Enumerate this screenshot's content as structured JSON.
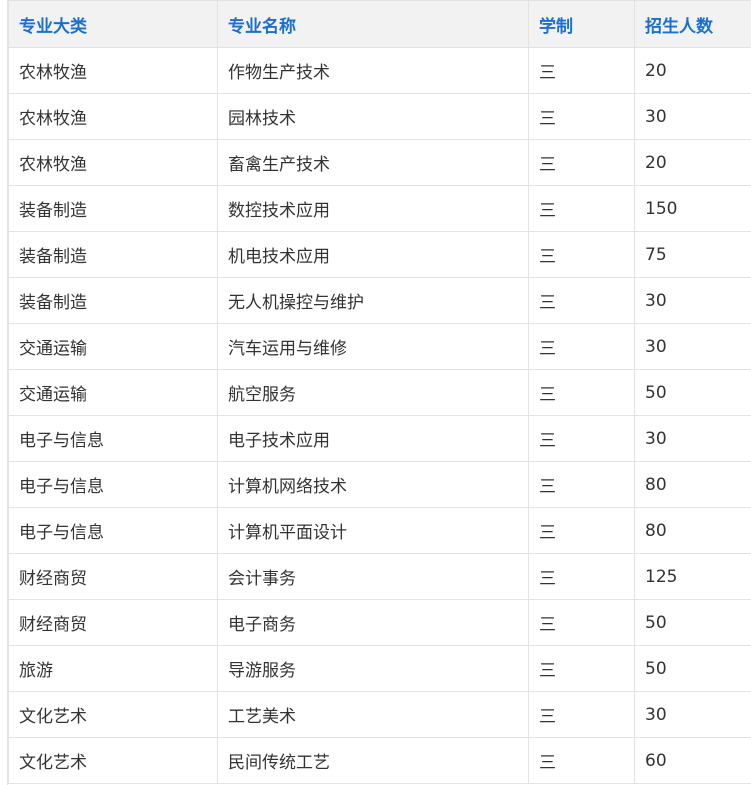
{
  "table": {
    "headers": [
      "专业大类",
      "专业名称",
      "学制",
      "招生人数"
    ],
    "rows": [
      [
        "农林牧渔",
        "作物生产技术",
        "三",
        "20"
      ],
      [
        "农林牧渔",
        "园林技术",
        "三",
        "30"
      ],
      [
        "农林牧渔",
        "畜禽生产技术",
        "三",
        "20"
      ],
      [
        "装备制造",
        "数控技术应用",
        "三",
        "150"
      ],
      [
        "装备制造",
        "机电技术应用",
        "三",
        "75"
      ],
      [
        "装备制造",
        "无人机操控与维护",
        "三",
        "30"
      ],
      [
        "交通运输",
        "汽车运用与维修",
        "三",
        "30"
      ],
      [
        "交通运输",
        "航空服务",
        "三",
        "50"
      ],
      [
        "电子与信息",
        "电子技术应用",
        "三",
        "30"
      ],
      [
        "电子与信息",
        "计算机网络技术",
        "三",
        "80"
      ],
      [
        "电子与信息",
        "计算机平面设计",
        "三",
        "80"
      ],
      [
        "财经商贸",
        "会计事务",
        "三",
        "125"
      ],
      [
        "财经商贸",
        "电子商务",
        "三",
        "50"
      ],
      [
        "旅游",
        "导游服务",
        "三",
        "50"
      ],
      [
        "文化艺术",
        "工艺美术",
        "三",
        "30"
      ],
      [
        "文化艺术",
        "民间传统工艺",
        "三",
        "60"
      ]
    ]
  },
  "colors": {
    "header_text": "#1a6fd1",
    "header_bg": "#f2f2f2",
    "cell_text": "#333333",
    "border": "#e3e3e3"
  }
}
